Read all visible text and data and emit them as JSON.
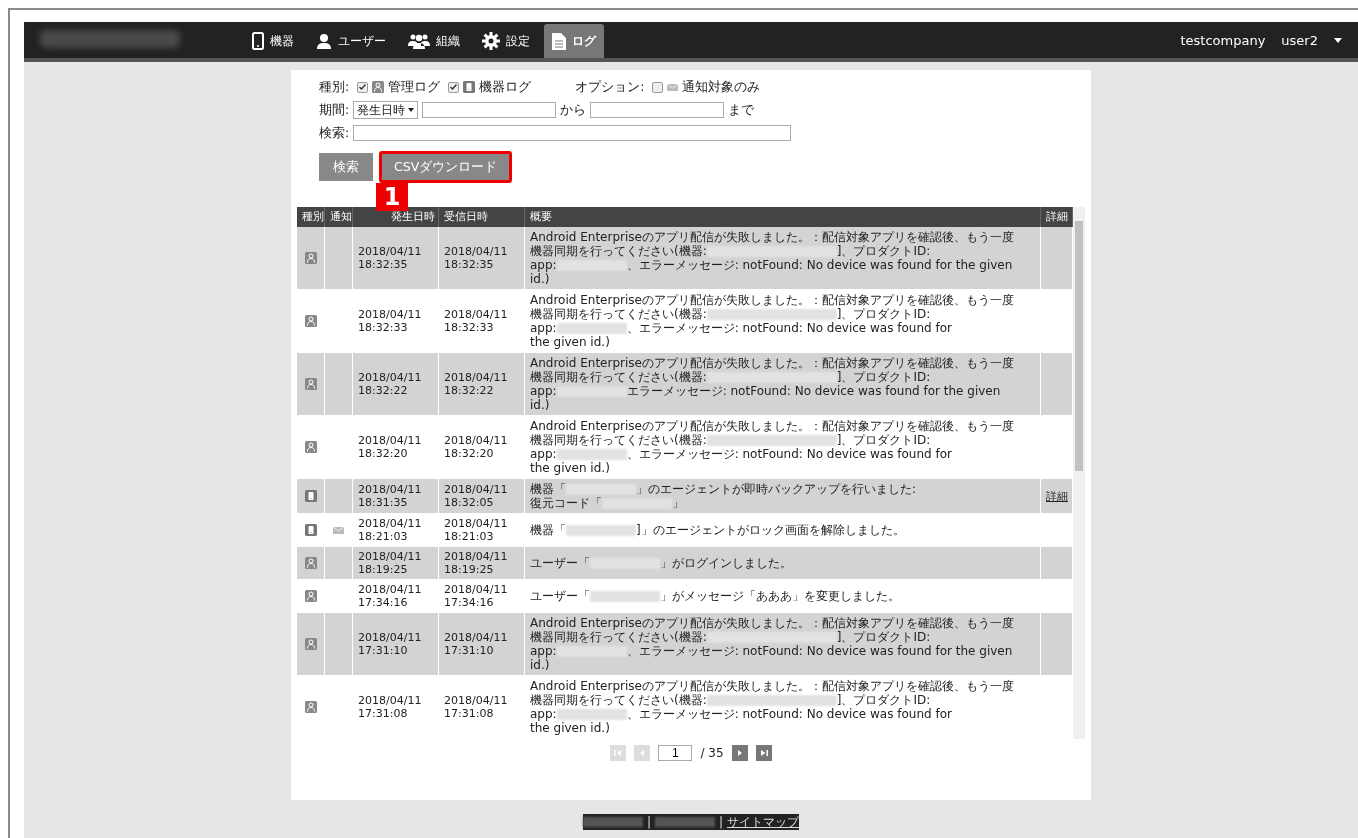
{
  "nav": {
    "tabs": [
      {
        "label": "機器",
        "kind": "phone",
        "selected": false
      },
      {
        "label": "ユーザー",
        "kind": "person",
        "selected": false
      },
      {
        "label": "組織",
        "kind": "group",
        "selected": false
      },
      {
        "label": "設定",
        "kind": "gear",
        "selected": false
      },
      {
        "label": "ログ",
        "kind": "file",
        "selected": true
      }
    ],
    "company": "testcompany",
    "user": "user2"
  },
  "filters": {
    "type_label": "種別:",
    "types": [
      {
        "label": "管理ログ",
        "kind": "admin",
        "checked": true
      },
      {
        "label": "機器ログ",
        "kind": "device",
        "checked": true
      }
    ],
    "option_label": "オプション:",
    "options": [
      {
        "label": "通知対象のみ",
        "checked": false
      }
    ],
    "period_label": "期間:",
    "period_select": "発生日時",
    "from_label": "から",
    "to_label": "まで",
    "search_label": "検索:"
  },
  "buttons": [
    {
      "label": "検索",
      "highlighted": false
    },
    {
      "label": "CSVダウンロード",
      "highlighted": true
    }
  ],
  "callout": "1",
  "table": {
    "columns": [
      "種別",
      "通知",
      "発生日時",
      "受信日時",
      "概要",
      "詳細"
    ],
    "rows": [
      {
        "kind": "admin",
        "notified": false,
        "occurred": "2018/04/11\n18:32:35",
        "received": "2018/04/11\n18:32:35",
        "summary": [
          [
            {
              "kind": "text",
              "text": "Android Enterpriseのアプリ配信が失敗しました。：配信対象アプリを確認後、もう一度"
            }
          ],
          [
            {
              "kind": "text",
              "text": "機器同期を行ってください(機器:"
            },
            {
              "kind": "redacted"
            },
            {
              "kind": "text",
              "text": "]、プロダクトID:"
            }
          ],
          [
            {
              "kind": "text",
              "text": "app:"
            },
            {
              "kind": "redacted"
            },
            {
              "kind": "text",
              "text": "、エラーメッセージ: notFound: No device was found for the given"
            }
          ],
          [
            {
              "kind": "text",
              "text": "id.)"
            }
          ]
        ]
      },
      {
        "kind": "admin",
        "notified": false,
        "occurred": "2018/04/11\n18:32:33",
        "received": "2018/04/11\n18:32:33",
        "summary": [
          [
            {
              "kind": "text",
              "text": "Android Enterpriseのアプリ配信が失敗しました。：配信対象アプリを確認後、もう一度"
            }
          ],
          [
            {
              "kind": "text",
              "text": "機器同期を行ってください(機器:"
            },
            {
              "kind": "redacted"
            },
            {
              "kind": "text",
              "text": "]、プロダクトID:"
            }
          ],
          [
            {
              "kind": "text",
              "text": "app:"
            },
            {
              "kind": "redacted"
            },
            {
              "kind": "text",
              "text": "、エラーメッセージ: notFound: No device was found for"
            }
          ],
          [
            {
              "kind": "text",
              "text": "the given id.)"
            }
          ]
        ]
      },
      {
        "kind": "admin",
        "notified": false,
        "occurred": "2018/04/11\n18:32:22",
        "received": "2018/04/11\n18:32:22",
        "summary": [
          [
            {
              "kind": "text",
              "text": "Android Enterpriseのアプリ配信が失敗しました。：配信対象アプリを確認後、もう一度"
            }
          ],
          [
            {
              "kind": "text",
              "text": "機器同期を行ってください(機器:"
            },
            {
              "kind": "redacted"
            },
            {
              "kind": "text",
              "text": "]、プロダクトID:"
            }
          ],
          [
            {
              "kind": "text",
              "text": "app:"
            },
            {
              "kind": "redacted"
            },
            {
              "kind": "text",
              "text": "エラーメッセージ: notFound: No device was found for the given"
            }
          ],
          [
            {
              "kind": "text",
              "text": "id.)"
            }
          ]
        ]
      },
      {
        "kind": "admin",
        "notified": false,
        "occurred": "2018/04/11\n18:32:20",
        "received": "2018/04/11\n18:32:20",
        "summary": [
          [
            {
              "kind": "text",
              "text": "Android Enterpriseのアプリ配信が失敗しました。：配信対象アプリを確認後、もう一度"
            }
          ],
          [
            {
              "kind": "text",
              "text": "機器同期を行ってください(機器:"
            },
            {
              "kind": "redacted"
            },
            {
              "kind": "text",
              "text": "]、プロダクトID:"
            }
          ],
          [
            {
              "kind": "text",
              "text": "app:"
            },
            {
              "kind": "redacted"
            },
            {
              "kind": "text",
              "text": "、エラーメッセージ: notFound: No device was found for"
            }
          ],
          [
            {
              "kind": "text",
              "text": "the given id.)"
            }
          ]
        ]
      },
      {
        "kind": "device",
        "notified": false,
        "occurred": "2018/04/11\n18:31:35",
        "received": "2018/04/11\n18:32:05",
        "summary": [
          [
            {
              "kind": "text",
              "text": "機器「"
            },
            {
              "kind": "redacted"
            },
            {
              "kind": "text",
              "text": "」のエージェントが即時バックアップを行いました:"
            }
          ],
          [
            {
              "kind": "text",
              "text": "復元コード「"
            },
            {
              "kind": "redacted"
            },
            {
              "kind": "text",
              "text": "」"
            }
          ]
        ],
        "detail": "詳細"
      },
      {
        "kind": "device",
        "notified": true,
        "occurred": "2018/04/11\n18:21:03",
        "received": "2018/04/11\n18:21:03",
        "summary": [
          [
            {
              "kind": "text",
              "text": "機器「"
            },
            {
              "kind": "redacted"
            },
            {
              "kind": "text",
              "text": "]」のエージェントがロック画面を解除しました。"
            }
          ]
        ]
      },
      {
        "kind": "admin",
        "notified": false,
        "occurred": "2018/04/11\n18:19:25",
        "received": "2018/04/11\n18:19:25",
        "summary": [
          [
            {
              "kind": "text",
              "text": "ユーザー「"
            },
            {
              "kind": "redacted"
            },
            {
              "kind": "text",
              "text": "」がログインしました。"
            }
          ]
        ]
      },
      {
        "kind": "admin",
        "notified": false,
        "occurred": "2018/04/11\n17:34:16",
        "received": "2018/04/11\n17:34:16",
        "summary": [
          [
            {
              "kind": "text",
              "text": "ユーザー「"
            },
            {
              "kind": "redacted"
            },
            {
              "kind": "text",
              "text": "」がメッセージ「あああ」を変更しました。"
            }
          ]
        ]
      },
      {
        "kind": "admin",
        "notified": false,
        "occurred": "2018/04/11\n17:31:10",
        "received": "2018/04/11\n17:31:10",
        "summary": [
          [
            {
              "kind": "text",
              "text": "Android Enterpriseのアプリ配信が失敗しました。：配信対象アプリを確認後、もう一度"
            }
          ],
          [
            {
              "kind": "text",
              "text": "機器同期を行ってください(機器:"
            },
            {
              "kind": "redacted"
            },
            {
              "kind": "text",
              "text": "]、プロダクトID:"
            }
          ],
          [
            {
              "kind": "text",
              "text": "app:"
            },
            {
              "kind": "redacted"
            },
            {
              "kind": "text",
              "text": "、エラーメッセージ: notFound: No device was found for the given"
            }
          ],
          [
            {
              "kind": "text",
              "text": "id.)"
            }
          ]
        ]
      },
      {
        "kind": "admin",
        "notified": false,
        "occurred": "2018/04/11\n17:31:08",
        "received": "2018/04/11\n17:31:08",
        "summary": [
          [
            {
              "kind": "text",
              "text": "Android Enterpriseのアプリ配信が失敗しました。：配信対象アプリを確認後、もう一度"
            }
          ],
          [
            {
              "kind": "text",
              "text": "機器同期を行ってください(機器:"
            },
            {
              "kind": "redacted"
            },
            {
              "kind": "text",
              "text": "]、プロダクトID:"
            }
          ],
          [
            {
              "kind": "text",
              "text": "app:"
            },
            {
              "kind": "redacted"
            },
            {
              "kind": "text",
              "text": "、エラーメッセージ: notFound: No device was found for"
            }
          ],
          [
            {
              "kind": "text",
              "text": "the given id.)"
            }
          ]
        ]
      }
    ]
  },
  "pagination": {
    "controls": [
      {
        "kind": "first",
        "disabled": true
      },
      {
        "kind": "prev",
        "disabled": true
      },
      {
        "kind": "next",
        "disabled": false
      },
      {
        "kind": "last",
        "disabled": false
      }
    ],
    "page": "1",
    "total": "/ 35"
  },
  "footer": [
    {
      "kind": "redacted"
    },
    {
      "kind": "text",
      "text": "|"
    },
    {
      "kind": "redacted"
    },
    {
      "kind": "text",
      "text": "|"
    },
    {
      "kind": "link",
      "text": "サイトマップ"
    }
  ]
}
